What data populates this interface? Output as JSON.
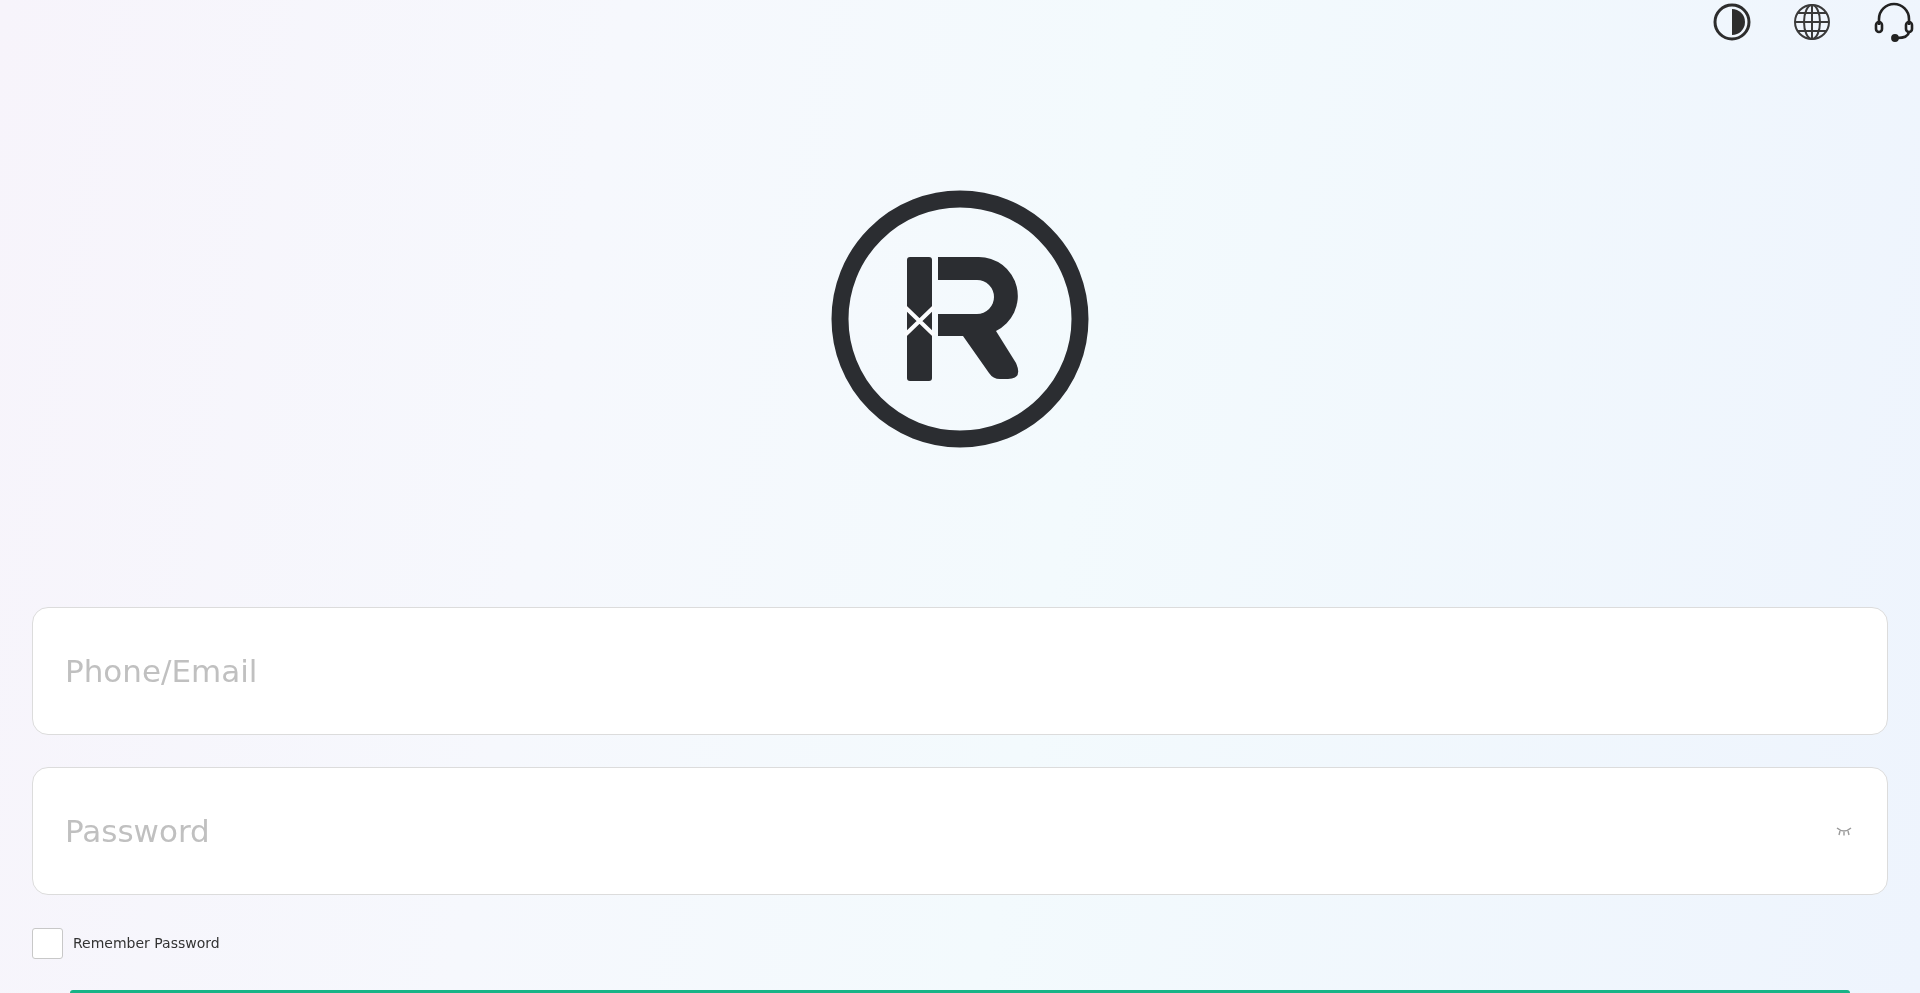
{
  "toolbar": [
    {
      "kind": "theme"
    },
    {
      "kind": "language"
    },
    {
      "kind": "support"
    }
  ],
  "fields": [
    {
      "kind": "text",
      "placeholder": "Phone/Email"
    },
    {
      "kind": "password",
      "placeholder": "Password",
      "password_visible": false
    }
  ],
  "remember": {
    "label": "Remember Password",
    "checked": false
  }
}
